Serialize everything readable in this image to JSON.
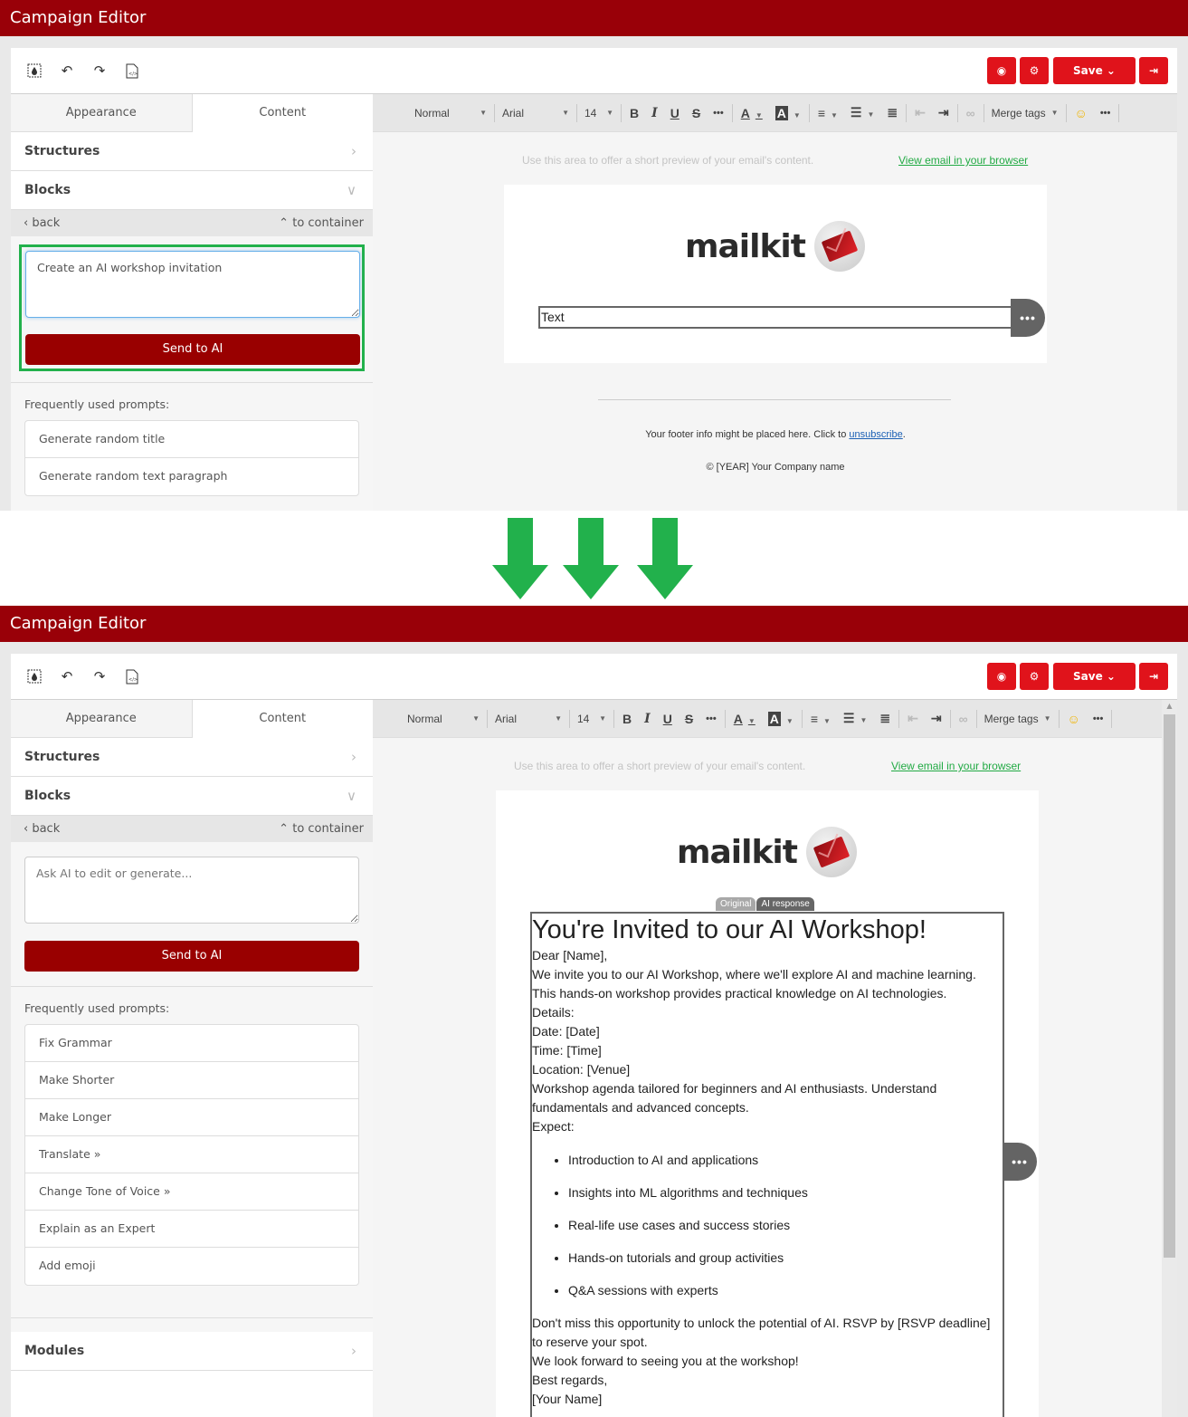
{
  "app_title": "Campaign Editor",
  "toolbar": {
    "icons": [
      "background-fill-icon",
      "undo-icon",
      "redo-icon",
      "html-code-icon"
    ],
    "preview_label": "preview",
    "settings_label": "settings",
    "save_label": "Save",
    "exit_label": "exit"
  },
  "sidebar": {
    "tabs": [
      {
        "label": "Appearance",
        "active": false
      },
      {
        "label": "Content",
        "active": true
      }
    ],
    "structures_label": "Structures",
    "blocks_label": "Blocks",
    "back_label": "back",
    "to_container_label": "to container",
    "send_label": "Send to AI",
    "frequent_label": "Frequently used prompts:",
    "modules_label": "Modules"
  },
  "before": {
    "prompt_value": "Create an AI workshop invitation",
    "prompts": [
      "Generate random title",
      "Generate random text paragraph"
    ],
    "text_block": "Text"
  },
  "after": {
    "prompt_placeholder": "Ask AI to edit or generate...",
    "prompts": [
      "Fix Grammar",
      "Make Shorter",
      "Make Longer",
      "Translate »",
      "Change Tone of Voice »",
      "Explain as an Expert",
      "Add emoji"
    ],
    "toggle": {
      "original": "Original",
      "ai_response": "AI response"
    },
    "ai_content": {
      "heading": "You're Invited to our AI Workshop!",
      "lines_before": [
        "Dear [Name],",
        "We invite you to our AI Workshop, where we'll explore AI and machine learning.",
        "This hands-on workshop provides practical knowledge on AI technologies.",
        "Details:",
        "Date: [Date]",
        "Time: [Time]",
        "Location: [Venue]",
        "Workshop agenda tailored for beginners and AI enthusiasts. Understand fundamentals and advanced concepts.",
        "Expect:"
      ],
      "bullets": [
        "Introduction to AI and applications",
        "Insights into ML algorithms and techniques",
        "Real-life use cases and success stories",
        "Hands-on tutorials and group activities",
        "Q&A sessions with experts"
      ],
      "lines_after": [
        "Don't miss this opportunity to unlock the potential of AI. RSVP by [RSVP deadline] to reserve your spot.",
        "We look forward to seeing you at the workshop!",
        "Best regards,",
        "[Your Name]"
      ]
    }
  },
  "formatbar": {
    "style": "Normal",
    "font": "Arial",
    "size": "14",
    "bold": "B",
    "italic": "I",
    "underline": "U",
    "strike": "S",
    "more": "•••",
    "merge_tags": "Merge tags"
  },
  "email": {
    "preheader": "Use this area to offer a short preview of your email's content.",
    "view_in_browser": "View email in your browser",
    "logo_text": "mailkit",
    "footer_text": "Your footer info might be placed here. Click to ",
    "unsubscribe": "unsubscribe",
    "footer_end": ".",
    "copyright": "© [YEAR] Your Company name"
  },
  "colors": {
    "brand": "#990008",
    "action_red": "#e0131b",
    "send_button": "#990000",
    "highlight_green": "#22b14c",
    "link_green": "#22aa44"
  }
}
